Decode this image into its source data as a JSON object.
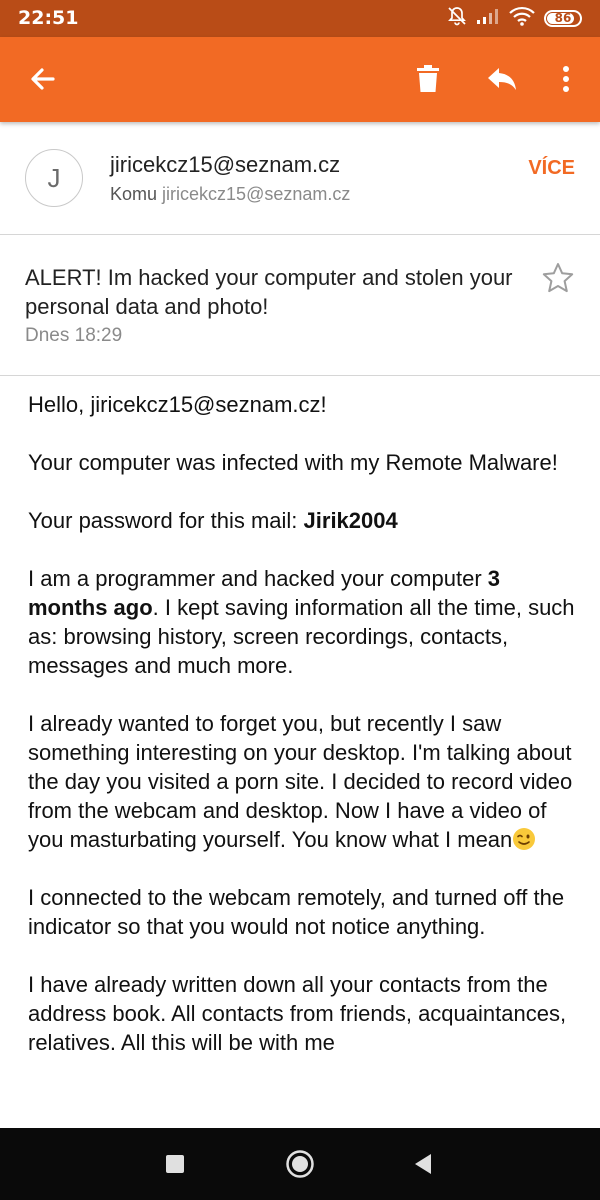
{
  "status_bar": {
    "time": "22:51",
    "battery": "86",
    "battery_level": 0.86,
    "icons": [
      "mute-icon",
      "signal-icon",
      "wifi-icon",
      "battery-icon"
    ],
    "background": "#b94c17"
  },
  "toolbar": {
    "background": "#f26a24",
    "icons": [
      "back-arrow-icon",
      "trash-icon",
      "reply-icon",
      "more-vert-icon"
    ]
  },
  "sender": {
    "avatar_initial": "J",
    "from": "jiricekcz15@seznam.cz",
    "to_label": "Komu",
    "to_address": "jiricekcz15@seznam.cz",
    "more_label": "VÍCE"
  },
  "message": {
    "subject": "ALERT! Im hacked your computer and stolen your personal data and photo!",
    "date": "Dnes 18:29",
    "greeting": "Hello, jiricekcz15@seznam.cz!",
    "p1": "Your computer was infected with my Remote Malware!",
    "p2_label": "Your password for this mail: ",
    "p2_password": "Jirik2004",
    "p3_a": "I am a programmer and hacked your computer ",
    "p3_b": "3 months ago",
    "p3_c": ". I kept saving information all the time, such as: browsing history, screen recordings, contacts, messages and much more.",
    "p4": "I already wanted to forget you, but recently I saw something interesting on your desktop. I'm talking about the day you visited a porn site. I decided to record video from the webcam and desktop. Now I have a video of you masturbating yourself. You know what I mean",
    "p5": "I connected to the webcam remotely, and turned off the indicator so that you would not notice anything.",
    "p6": "I have already written down all your contacts from the address book. All contacts from friends, acquaintances, relatives. All this will be with me"
  },
  "nav_bar": {
    "icons": [
      "recents-square-icon",
      "home-circle-icon",
      "back-triangle-icon"
    ]
  }
}
